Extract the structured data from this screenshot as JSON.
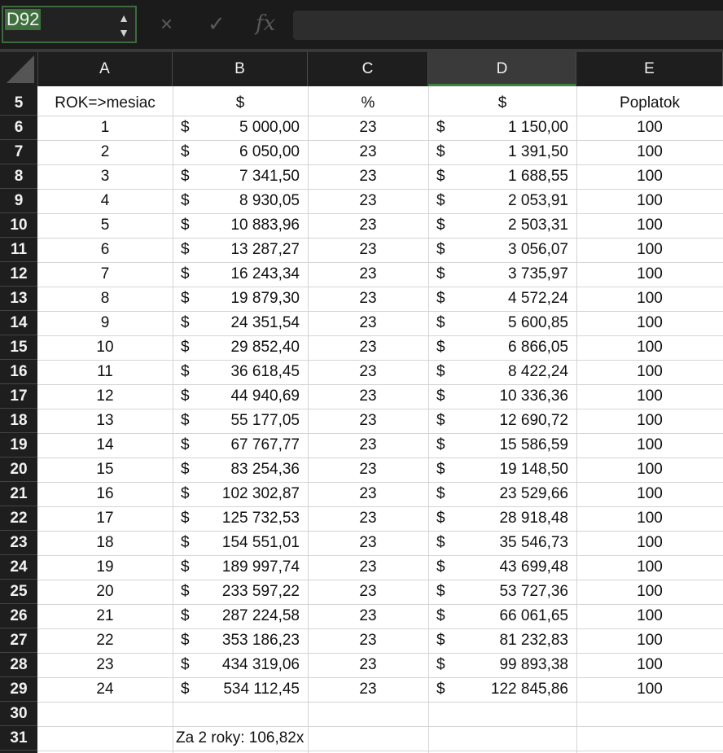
{
  "name_box": "D92",
  "icons": {
    "cancel": "×",
    "confirm": "✓",
    "function": "fx"
  },
  "columns": [
    "A",
    "B",
    "C",
    "D",
    "E"
  ],
  "header_row": {
    "row": "5",
    "a": "ROK=>mesiac",
    "b": "$",
    "c": "%",
    "d": "$",
    "e": "Poplatok"
  },
  "rows": [
    {
      "row": "6",
      "a": "1",
      "b_sym": "$",
      "b": "5 000,00",
      "c": "23",
      "d_sym": "$",
      "d": "1 150,00",
      "e": "100"
    },
    {
      "row": "7",
      "a": "2",
      "b_sym": "$",
      "b": "6 050,00",
      "c": "23",
      "d_sym": "$",
      "d": "1 391,50",
      "e": "100"
    },
    {
      "row": "8",
      "a": "3",
      "b_sym": "$",
      "b": "7 341,50",
      "c": "23",
      "d_sym": "$",
      "d": "1 688,55",
      "e": "100"
    },
    {
      "row": "9",
      "a": "4",
      "b_sym": "$",
      "b": "8 930,05",
      "c": "23",
      "d_sym": "$",
      "d": "2 053,91",
      "e": "100"
    },
    {
      "row": "10",
      "a": "5",
      "b_sym": "$",
      "b": "10 883,96",
      "c": "23",
      "d_sym": "$",
      "d": "2 503,31",
      "e": "100"
    },
    {
      "row": "11",
      "a": "6",
      "b_sym": "$",
      "b": "13 287,27",
      "c": "23",
      "d_sym": "$",
      "d": "3 056,07",
      "e": "100"
    },
    {
      "row": "12",
      "a": "7",
      "b_sym": "$",
      "b": "16 243,34",
      "c": "23",
      "d_sym": "$",
      "d": "3 735,97",
      "e": "100"
    },
    {
      "row": "13",
      "a": "8",
      "b_sym": "$",
      "b": "19 879,30",
      "c": "23",
      "d_sym": "$",
      "d": "4 572,24",
      "e": "100"
    },
    {
      "row": "14",
      "a": "9",
      "b_sym": "$",
      "b": "24 351,54",
      "c": "23",
      "d_sym": "$",
      "d": "5 600,85",
      "e": "100"
    },
    {
      "row": "15",
      "a": "10",
      "b_sym": "$",
      "b": "29 852,40",
      "c": "23",
      "d_sym": "$",
      "d": "6 866,05",
      "e": "100"
    },
    {
      "row": "16",
      "a": "11",
      "b_sym": "$",
      "b": "36 618,45",
      "c": "23",
      "d_sym": "$",
      "d": "8 422,24",
      "e": "100"
    },
    {
      "row": "17",
      "a": "12",
      "b_sym": "$",
      "b": "44 940,69",
      "c": "23",
      "d_sym": "$",
      "d": "10 336,36",
      "e": "100"
    },
    {
      "row": "18",
      "a": "13",
      "b_sym": "$",
      "b": "55 177,05",
      "c": "23",
      "d_sym": "$",
      "d": "12 690,72",
      "e": "100"
    },
    {
      "row": "19",
      "a": "14",
      "b_sym": "$",
      "b": "67 767,77",
      "c": "23",
      "d_sym": "$",
      "d": "15 586,59",
      "e": "100"
    },
    {
      "row": "20",
      "a": "15",
      "b_sym": "$",
      "b": "83 254,36",
      "c": "23",
      "d_sym": "$",
      "d": "19 148,50",
      "e": "100"
    },
    {
      "row": "21",
      "a": "16",
      "b_sym": "$",
      "b": "102 302,87",
      "c": "23",
      "d_sym": "$",
      "d": "23 529,66",
      "e": "100"
    },
    {
      "row": "22",
      "a": "17",
      "b_sym": "$",
      "b": "125 732,53",
      "c": "23",
      "d_sym": "$",
      "d": "28 918,48",
      "e": "100"
    },
    {
      "row": "23",
      "a": "18",
      "b_sym": "$",
      "b": "154 551,01",
      "c": "23",
      "d_sym": "$",
      "d": "35 546,73",
      "e": "100"
    },
    {
      "row": "24",
      "a": "19",
      "b_sym": "$",
      "b": "189 997,74",
      "c": "23",
      "d_sym": "$",
      "d": "43 699,48",
      "e": "100"
    },
    {
      "row": "25",
      "a": "20",
      "b_sym": "$",
      "b": "233 597,22",
      "c": "23",
      "d_sym": "$",
      "d": "53 727,36",
      "e": "100"
    },
    {
      "row": "26",
      "a": "21",
      "b_sym": "$",
      "b": "287 224,58",
      "c": "23",
      "d_sym": "$",
      "d": "66 061,65",
      "e": "100"
    },
    {
      "row": "27",
      "a": "22",
      "b_sym": "$",
      "b": "353 186,23",
      "c": "23",
      "d_sym": "$",
      "d": "81 232,83",
      "e": "100"
    },
    {
      "row": "28",
      "a": "23",
      "b_sym": "$",
      "b": "434 319,06",
      "c": "23",
      "d_sym": "$",
      "d": "99 893,38",
      "e": "100"
    },
    {
      "row": "29",
      "a": "24",
      "b_sym": "$",
      "b": "534 112,45",
      "c": "23",
      "d_sym": "$",
      "d": "122 845,86",
      "e": "100"
    }
  ],
  "empty_rows": [
    "30"
  ],
  "summary_row": {
    "row": "31",
    "b": "Za 2 roky: 106,82x"
  }
}
